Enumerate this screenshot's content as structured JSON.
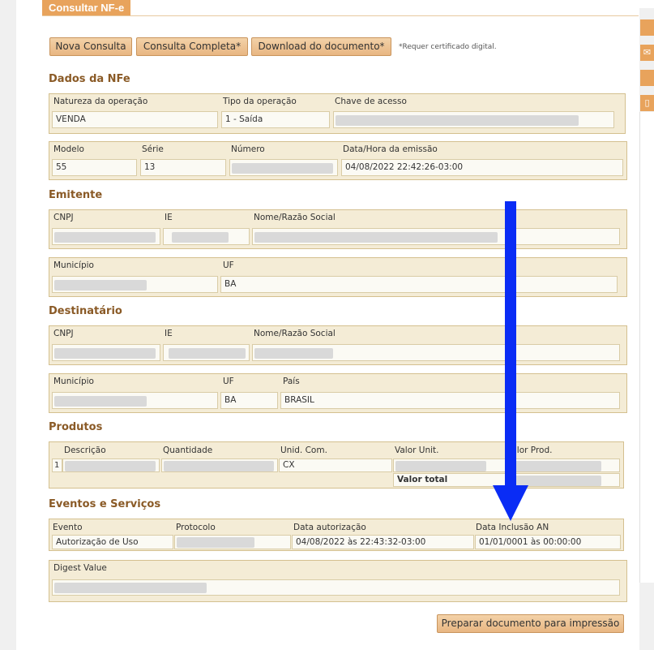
{
  "header": {
    "title": "Consultar NF-e"
  },
  "toolbar": {
    "nova_consulta": "Nova Consulta",
    "consulta_completa": "Consulta Completa*",
    "download": "Download do documento*",
    "note": "*Requer certificado digital."
  },
  "dados_nfe": {
    "title": "Dados da NFe",
    "natureza_label": "Natureza da operação",
    "natureza_value": "VENDA",
    "tipo_label": "Tipo da operação",
    "tipo_value": "1 - Saída",
    "chave_label": "Chave de acesso",
    "modelo_label": "Modelo",
    "modelo_value": "55",
    "serie_label": "Série",
    "serie_value": "13",
    "numero_label": "Número",
    "data_label": "Data/Hora da emissão",
    "data_value": "04/08/2022 22:42:26-03:00"
  },
  "emitente": {
    "title": "Emitente",
    "cnpj_label": "CNPJ",
    "ie_label": "IE",
    "nome_label": "Nome/Razão Social",
    "municipio_label": "Município",
    "uf_label": "UF",
    "uf_value": "BA"
  },
  "destinatario": {
    "title": "Destinatário",
    "cnpj_label": "CNPJ",
    "ie_label": "IE",
    "nome_label": "Nome/Razão Social",
    "municipio_label": "Município",
    "uf_label": "UF",
    "uf_value": "BA",
    "pais_label": "País",
    "pais_value": "BRASIL"
  },
  "produtos": {
    "title": "Produtos",
    "col_descricao": "Descrição",
    "col_quantidade": "Quantidade",
    "col_unid": "Unid. Com.",
    "col_valor_unit": "Valor Unit.",
    "col_valor_prod": "Valor Prod.",
    "row_index": "1",
    "row_unid": "CX",
    "valor_total_label": "Valor total"
  },
  "eventos": {
    "title": "Eventos e Serviços",
    "col_evento": "Evento",
    "col_protocolo": "Protocolo",
    "col_data_autorizacao": "Data autorização",
    "col_data_inclusao": "Data Inclusão AN",
    "evento_value": "Autorização de Uso",
    "data_autorizacao_value": "04/08/2022 às 22:43:32-03:00",
    "data_inclusao_value": "01/01/0001 às 00:00:00",
    "digest_label": "Digest Value"
  },
  "footer": {
    "print_button": "Preparar documento para impressão"
  },
  "colors": {
    "accent": "#e8a35c",
    "section_title": "#8a5a26",
    "box_bg": "#f4ecd6",
    "arrow": "#0a2cf5"
  },
  "icons": [
    "rail-tab-icon",
    "mail-icon",
    "rail-tab-icon",
    "document-icon",
    "down-arrow-icon"
  ]
}
